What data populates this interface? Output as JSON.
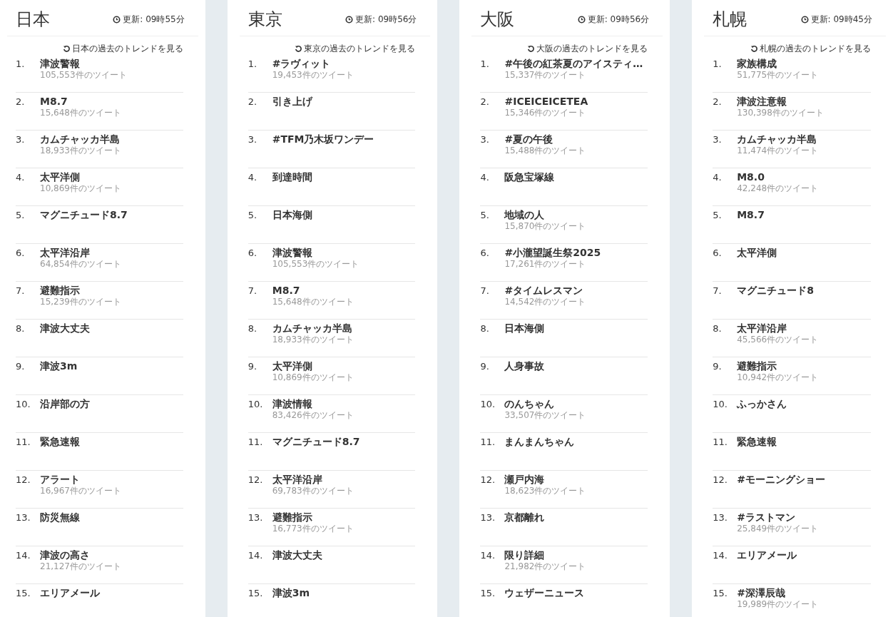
{
  "columns": [
    {
      "region": "日本",
      "updated": "更新: 09時55分",
      "history_link": "日本の過去のトレンドを見る",
      "trends": [
        {
          "rank": "1.",
          "name": "津波警報",
          "count": "105,553件のツイート"
        },
        {
          "rank": "2.",
          "name": "M8.7",
          "count": "15,648件のツイート"
        },
        {
          "rank": "3.",
          "name": "カムチャッカ半島",
          "count": "18,933件のツイート"
        },
        {
          "rank": "4.",
          "name": "太平洋側",
          "count": "10,869件のツイート"
        },
        {
          "rank": "5.",
          "name": "マグニチュード8.7"
        },
        {
          "rank": "6.",
          "name": "太平洋沿岸",
          "count": "64,854件のツイート"
        },
        {
          "rank": "7.",
          "name": "避難指示",
          "count": "15,239件のツイート"
        },
        {
          "rank": "8.",
          "name": "津波大丈夫"
        },
        {
          "rank": "9.",
          "name": "津波3m"
        },
        {
          "rank": "10.",
          "name": "沿岸部の方"
        },
        {
          "rank": "11.",
          "name": "緊急速報"
        },
        {
          "rank": "12.",
          "name": "アラート",
          "count": "16,967件のツイート"
        },
        {
          "rank": "13.",
          "name": "防災無線"
        },
        {
          "rank": "14.",
          "name": "津波の高さ",
          "count": "21,127件のツイート"
        },
        {
          "rank": "15.",
          "name": "エリアメール"
        }
      ]
    },
    {
      "region": "東京",
      "updated": "更新: 09時56分",
      "history_link": "東京の過去のトレンドを見る",
      "trends": [
        {
          "rank": "1.",
          "name": "#ラヴィット",
          "count": "19,453件のツイート"
        },
        {
          "rank": "2.",
          "name": "引き上げ"
        },
        {
          "rank": "3.",
          "name": "#TFM乃木坂ワンデー"
        },
        {
          "rank": "4.",
          "name": "到達時間"
        },
        {
          "rank": "5.",
          "name": "日本海側"
        },
        {
          "rank": "6.",
          "name": "津波警報",
          "count": "105,553件のツイート"
        },
        {
          "rank": "7.",
          "name": "M8.7",
          "count": "15,648件のツイート"
        },
        {
          "rank": "8.",
          "name": "カムチャッカ半島",
          "count": "18,933件のツイート"
        },
        {
          "rank": "9.",
          "name": "太平洋側",
          "count": "10,869件のツイート"
        },
        {
          "rank": "10.",
          "name": "津波情報",
          "count": "83,426件のツイート"
        },
        {
          "rank": "11.",
          "name": "マグニチュード8.7"
        },
        {
          "rank": "12.",
          "name": "太平洋沿岸",
          "count": "69,783件のツイート"
        },
        {
          "rank": "13.",
          "name": "避難指示",
          "count": "16,773件のツイート"
        },
        {
          "rank": "14.",
          "name": "津波大丈夫"
        },
        {
          "rank": "15.",
          "name": "津波3m"
        }
      ]
    },
    {
      "region": "大阪",
      "updated": "更新: 09時56分",
      "history_link": "大阪の過去のトレンドを見る",
      "trends": [
        {
          "rank": "1.",
          "name": "#午後の紅茶夏のアイスティ…",
          "count": "15,337件のツイート"
        },
        {
          "rank": "2.",
          "name": "#ICEICEICETEA",
          "count": "15,346件のツイート"
        },
        {
          "rank": "3.",
          "name": "#夏の午後",
          "count": "15,488件のツイート"
        },
        {
          "rank": "4.",
          "name": "阪急宝塚線"
        },
        {
          "rank": "5.",
          "name": "地域の人",
          "count": "15,870件のツイート"
        },
        {
          "rank": "6.",
          "name": "#小瀧望誕生祭2025",
          "count": "17,261件のツイート"
        },
        {
          "rank": "7.",
          "name": "#タイムレスマン",
          "count": "14,542件のツイート"
        },
        {
          "rank": "8.",
          "name": "日本海側"
        },
        {
          "rank": "9.",
          "name": "人身事故"
        },
        {
          "rank": "10.",
          "name": "のんちゃん",
          "count": "33,507件のツイート"
        },
        {
          "rank": "11.",
          "name": "まんまんちゃん"
        },
        {
          "rank": "12.",
          "name": "瀬戸内海",
          "count": "18,623件のツイート"
        },
        {
          "rank": "13.",
          "name": "京都離れ"
        },
        {
          "rank": "14.",
          "name": "限り詳細",
          "count": "21,982件のツイート"
        },
        {
          "rank": "15.",
          "name": "ウェザーニュース"
        }
      ]
    },
    {
      "region": "札幌",
      "updated": "更新: 09時45分",
      "history_link": "札幌の過去のトレンドを見る",
      "trends": [
        {
          "rank": "1.",
          "name": "家族構成",
          "count": "51,775件のツイート"
        },
        {
          "rank": "2.",
          "name": "津波注意報",
          "count": "130,398件のツイート"
        },
        {
          "rank": "3.",
          "name": "カムチャッカ半島",
          "count": "11,474件のツイート"
        },
        {
          "rank": "4.",
          "name": "M8.0",
          "count": "42,248件のツイート"
        },
        {
          "rank": "5.",
          "name": "M8.7"
        },
        {
          "rank": "6.",
          "name": "太平洋側"
        },
        {
          "rank": "7.",
          "name": "マグニチュード8"
        },
        {
          "rank": "8.",
          "name": "太平洋沿岸",
          "count": "45,566件のツイート"
        },
        {
          "rank": "9.",
          "name": "避難指示",
          "count": "10,942件のツイート"
        },
        {
          "rank": "10.",
          "name": "ふっかさん"
        },
        {
          "rank": "11.",
          "name": "緊急速報"
        },
        {
          "rank": "12.",
          "name": "#モーニングショー"
        },
        {
          "rank": "13.",
          "name": "#ラストマン",
          "count": "25,849件のツイート"
        },
        {
          "rank": "14.",
          "name": "エリアメール"
        },
        {
          "rank": "15.",
          "name": "#深澤辰哉",
          "count": "19,989件のツイート"
        }
      ]
    }
  ]
}
